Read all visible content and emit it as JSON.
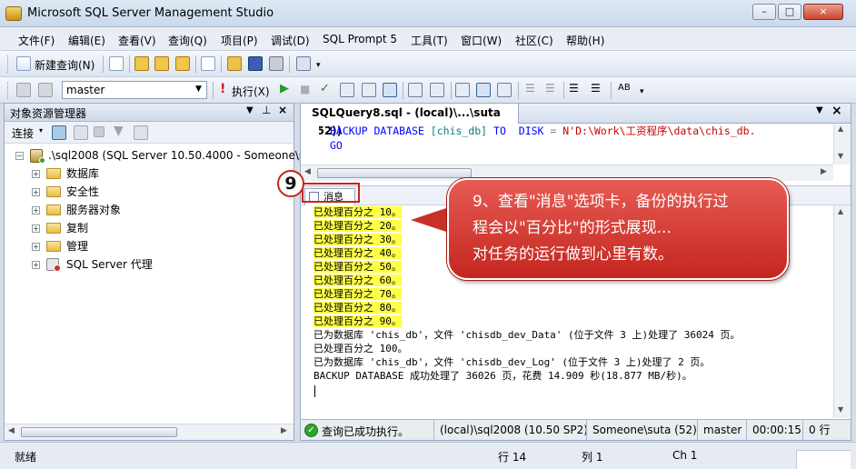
{
  "window": {
    "title": "Microsoft SQL Server Management Studio",
    "controls": [
      "–",
      "□",
      "×"
    ]
  },
  "menu": [
    "文件(F)",
    "编辑(E)",
    "查看(V)",
    "查询(Q)",
    "项目(P)",
    "调试(D)",
    "SQL Prompt 5",
    "工具(T)",
    "窗口(W)",
    "社区(C)",
    "帮助(H)"
  ],
  "toolbar1": {
    "new_query": "新建查询(N)"
  },
  "toolbar2": {
    "database": "master",
    "execute": "执行(X)"
  },
  "object_explorer": {
    "title": "对象资源管理器",
    "connect": "连接",
    "server": ".\\sql2008 (SQL Server 10.50.4000 - Someone\\s",
    "nodes": [
      "数据库",
      "安全性",
      "服务器对象",
      "复制",
      "管理",
      "SQL Server 代理"
    ]
  },
  "editor": {
    "tab_title": "SQLQuery8.sql - (local)\\...\\suta (52))",
    "code_line1_kw": "BACKUP DATABASE",
    "code_line1_db": "[chis_db]",
    "code_line1_to": "TO",
    "code_line1_disk": "DISK",
    "code_line1_eq": "=",
    "code_line1_path": "N'D:\\Work\\工资程序\\data\\chis_db.",
    "code_line2": "GO"
  },
  "results": {
    "tab_label": "消息",
    "progress_lines": [
      "已处理百分之 10。",
      "已处理百分之 20。",
      "已处理百分之 30。",
      "已处理百分之 40。",
      "已处理百分之 50。",
      "已处理百分之 60。",
      "已处理百分之 70。",
      "已处理百分之 80。",
      "已处理百分之 90。"
    ],
    "other_lines": [
      "已为数据库 'chis_db'，文件 'chisdb_dev_Data' (位于文件 3 上)处理了 36024 页。",
      "已处理百分之 100。",
      "已为数据库 'chis_db'，文件 'chisdb_dev_Log' (位于文件 3 上)处理了 2 页。",
      "BACKUP DATABASE 成功处理了 36026 页，花费 14.909 秒(18.877 MB/秒)。"
    ]
  },
  "query_status": {
    "message": "查询已成功执行。",
    "server": "(local)\\sql2008 (10.50 SP2)",
    "user": "Someone\\suta (52)",
    "database": "master",
    "elapsed": "00:00:15",
    "rows": "0 行"
  },
  "statusbar": {
    "ready": "就绪",
    "line": "行 14",
    "col": "列 1",
    "ch": "Ch 1"
  },
  "annotation": {
    "step_number": "9",
    "callout_lines": [
      "9、查看\"消息\"选项卡，备份的执行过",
      "程会以\"百分比\"的形式展现...",
      "对任务的运行做到心里有数。"
    ]
  },
  "colors": {
    "highlight": "#ffff4a",
    "callout": "#d6352d",
    "keyword": "#0000ff",
    "string": "#cc0000"
  }
}
